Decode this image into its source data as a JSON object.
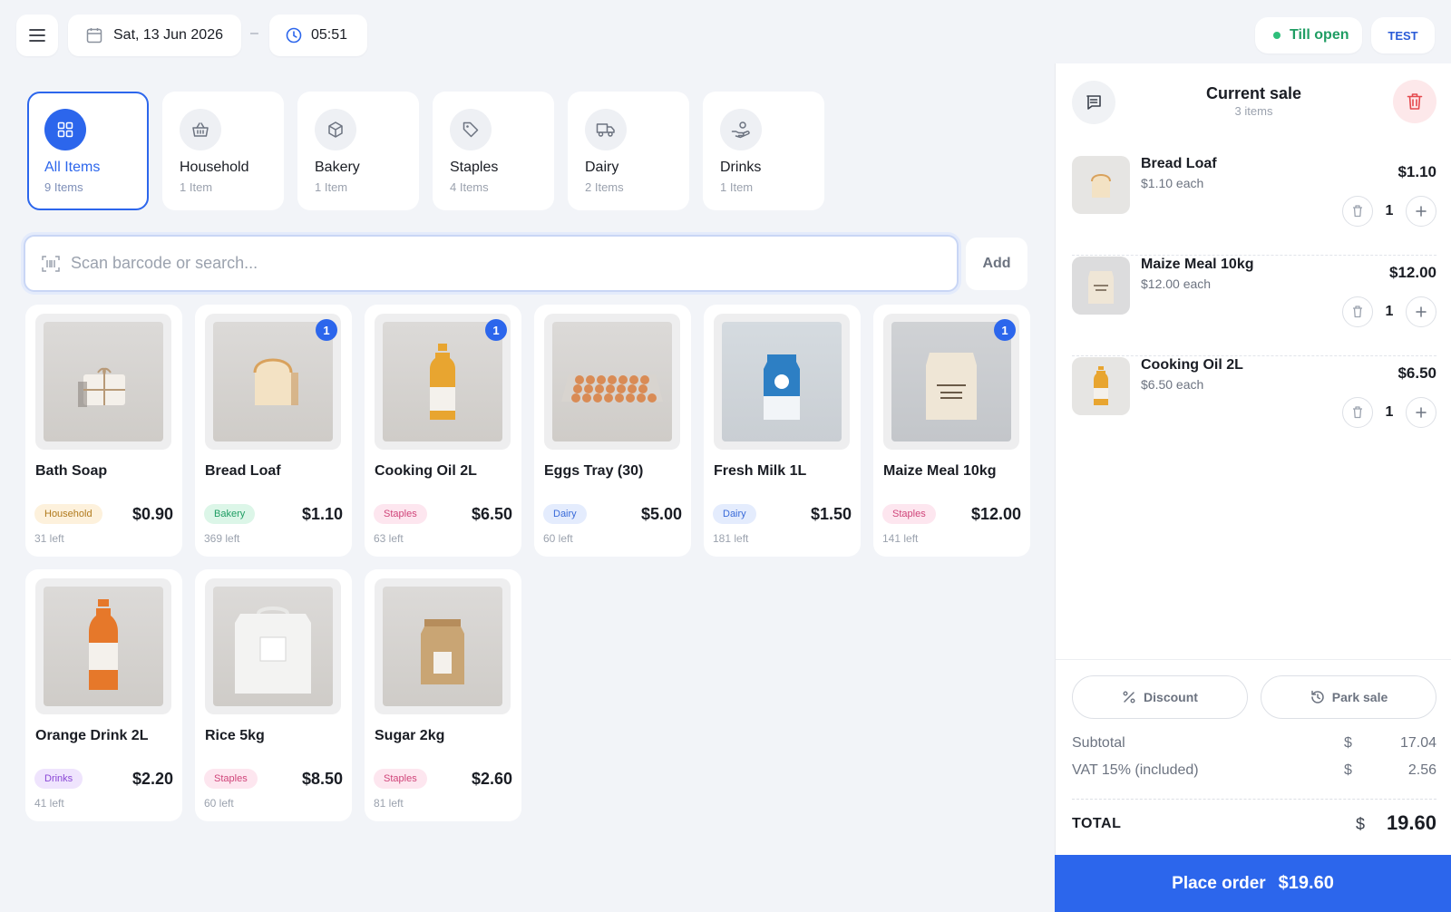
{
  "header": {
    "date": "Sat, 13 Jun 2026",
    "separator": "–",
    "time": "05:51",
    "till_status": "Till open",
    "mode_badge": "TEST"
  },
  "categories": [
    {
      "name": "All Items",
      "count": "9 Items",
      "icon": "grid-icon",
      "active": true
    },
    {
      "name": "Household",
      "count": "1 Item",
      "icon": "basket-icon"
    },
    {
      "name": "Bakery",
      "count": "1 Item",
      "icon": "box-icon"
    },
    {
      "name": "Staples",
      "count": "4 Items",
      "icon": "tag-icon"
    },
    {
      "name": "Dairy",
      "count": "2 Items",
      "icon": "truck-icon"
    },
    {
      "name": "Drinks",
      "count": "1 Item",
      "icon": "hand-coins-icon"
    }
  ],
  "search": {
    "placeholder": "Scan barcode or search...",
    "value": "",
    "add_label": "Add"
  },
  "products": [
    {
      "name": "Bath Soap",
      "tag": "Household",
      "price": "$0.90",
      "stock": "31 left",
      "in_cart": ""
    },
    {
      "name": "Bread Loaf",
      "tag": "Bakery",
      "price": "$1.10",
      "stock": "369 left",
      "in_cart": "1"
    },
    {
      "name": "Cooking Oil 2L",
      "tag": "Staples",
      "price": "$6.50",
      "stock": "63 left",
      "in_cart": "1"
    },
    {
      "name": "Eggs Tray (30)",
      "tag": "Dairy",
      "price": "$5.00",
      "stock": "60 left",
      "in_cart": ""
    },
    {
      "name": "Fresh Milk 1L",
      "tag": "Dairy",
      "price": "$1.50",
      "stock": "181 left",
      "in_cart": ""
    },
    {
      "name": "Maize Meal 10kg",
      "tag": "Staples",
      "price": "$12.00",
      "stock": "141 left",
      "in_cart": "1"
    },
    {
      "name": "Orange Drink 2L",
      "tag": "Drinks",
      "price": "$2.20",
      "stock": "41 left",
      "in_cart": ""
    },
    {
      "name": "Rice 5kg",
      "tag": "Staples",
      "price": "$8.50",
      "stock": "60 left",
      "in_cart": ""
    },
    {
      "name": "Sugar 2kg",
      "tag": "Staples",
      "price": "$2.60",
      "stock": "81 left",
      "in_cart": ""
    }
  ],
  "sale": {
    "title": "Current sale",
    "count": "3 items",
    "lines": [
      {
        "name": "Bread Loaf",
        "each": "$1.10 each",
        "total": "$1.10",
        "qty": "1"
      },
      {
        "name": "Maize Meal 10kg",
        "each": "$12.00 each",
        "total": "$12.00",
        "qty": "1"
      },
      {
        "name": "Cooking Oil 2L",
        "each": "$6.50 each",
        "total": "$6.50",
        "qty": "1"
      }
    ],
    "discount_label": "Discount",
    "park_label": "Park sale",
    "subtotal_label": "Subtotal",
    "subtotal_currency": "$",
    "subtotal_value": "17.04",
    "vat_label": "VAT 15% (included)",
    "vat_currency": "$",
    "vat_value": "2.56",
    "total_label": "TOTAL",
    "total_currency": "$",
    "total_value": "19.60",
    "place_label": "Place order",
    "place_amount": "$19.60"
  },
  "colors": {
    "accent": "#2c66ec",
    "till_open": "#1f9d63",
    "danger": "#e5484d"
  }
}
